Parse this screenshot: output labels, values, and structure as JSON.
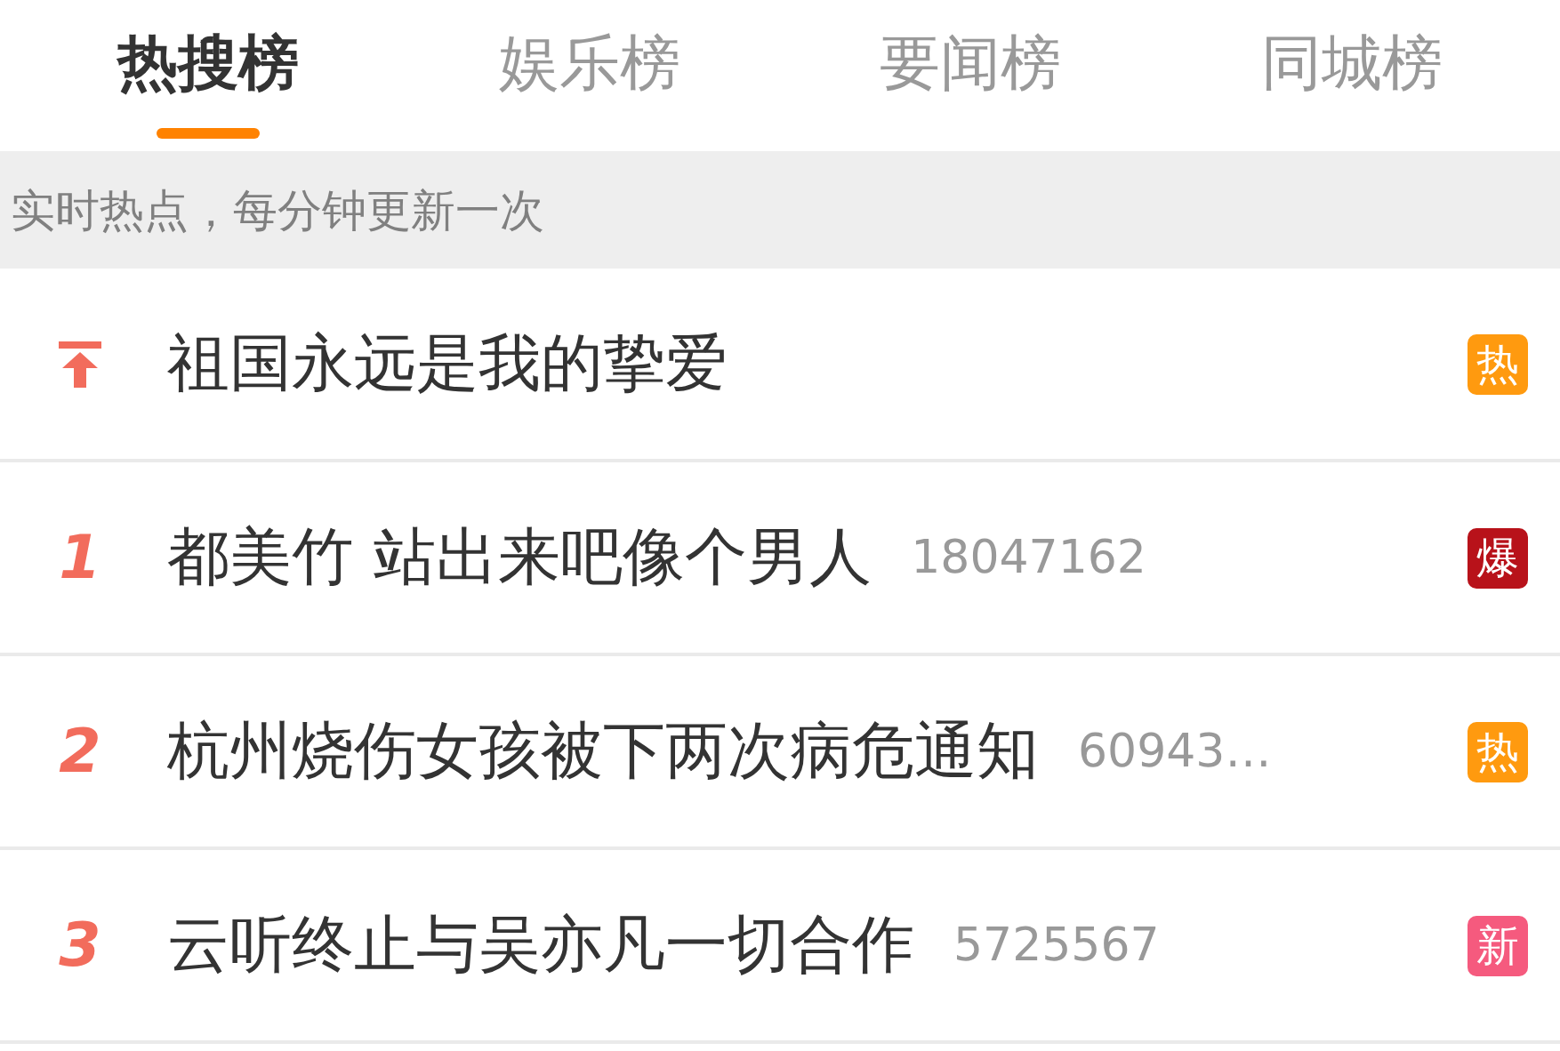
{
  "tabs": [
    {
      "label": "热搜榜",
      "selected": true
    },
    {
      "label": "娱乐榜",
      "selected": false
    },
    {
      "label": "要闻榜",
      "selected": false
    },
    {
      "label": "同城榜",
      "selected": false
    }
  ],
  "notice": "实时热点，每分钟更新一次",
  "items": [
    {
      "kind": "pinned",
      "title": "祖国永远是我的挚爱",
      "badge": "热",
      "color": "#ff9a0f"
    },
    {
      "kind": "ranked",
      "rank": "1",
      "title": "都美竹 站出来吧像个男人",
      "count": "18047162",
      "badge": "爆",
      "color": "#b8121a"
    },
    {
      "kind": "ranked",
      "rank": "2",
      "title": "杭州烧伤女孩被下两次病危通知",
      "count": "60943…",
      "badge": "热",
      "color": "#ff9a0f"
    },
    {
      "kind": "ranked",
      "rank": "3",
      "title": "云听终止与吴亦凡一切合作",
      "count": "5725567",
      "badge": "新",
      "color": "#f55a7e"
    }
  ]
}
